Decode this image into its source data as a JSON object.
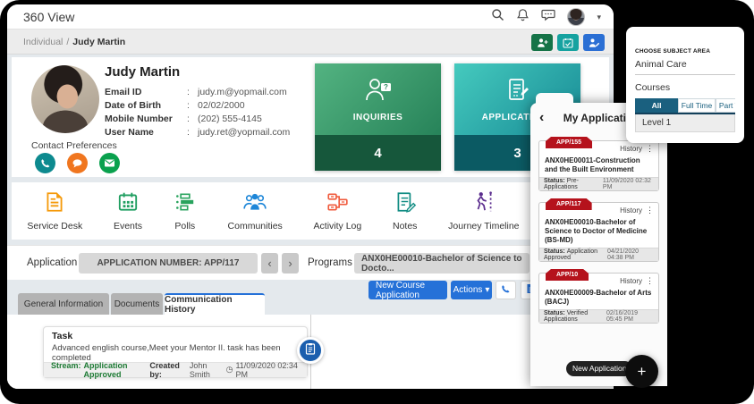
{
  "colors": {
    "primary_blue": "#2571d8",
    "inquiries_green": "#2c8a5f",
    "applications_teal": "#1ba0a5",
    "ribbon_red": "#b5121c",
    "segment_active": "#1a607f",
    "stream_green": "#1d7a34",
    "frame_black": "#000000"
  },
  "icons": {
    "caret": "▾",
    "chevron_left": "‹",
    "chevron_right": "›",
    "back": "‹",
    "ellipsis": "⋮",
    "plus": "+",
    "clock": "◷",
    "breadcrumb_sep": "/"
  },
  "topbar": {
    "title": "360 View"
  },
  "breadcrumb": {
    "section": "Individual",
    "current": "Judy Martin"
  },
  "profile": {
    "name": "Judy Martin",
    "colon": ":",
    "fields": [
      {
        "label": "Email ID",
        "value": "judy.m@yopmail.com"
      },
      {
        "label": "Date of Birth",
        "value": "02/02/2000"
      },
      {
        "label": "Mobile Number",
        "value": "(202) 555-4145"
      },
      {
        "label": "User Name",
        "value": "judy.ret@yopmail.com"
      }
    ],
    "contact_label": "Contact Preferences"
  },
  "metrics": [
    {
      "label": "INQUIRIES",
      "count": "4"
    },
    {
      "label": "APPLICATIONS",
      "count": "3"
    }
  ],
  "quick_links": [
    {
      "label": "Service Desk"
    },
    {
      "label": "Events"
    },
    {
      "label": "Polls"
    },
    {
      "label": "Communities"
    },
    {
      "label": "Activity Log"
    },
    {
      "label": "Notes"
    },
    {
      "label": "Journey Timeline"
    }
  ],
  "app_bar": {
    "application_label": "Application",
    "application_number": "APPLICATION NUMBER: APP/117",
    "programs_label": "Programs",
    "program_value": "ANX0HE00010-Bachelor of Science to Docto..."
  },
  "actions": {
    "new_course": "New Course Application",
    "actions_label": "Actions"
  },
  "tabs": [
    {
      "label": "General Information"
    },
    {
      "label": "Documents"
    },
    {
      "label": "Communication History"
    }
  ],
  "task": {
    "title": "Task",
    "body": "Advanced english course,Meet your Mentor II. task has been completed",
    "stream_label": "Stream:",
    "stream_value": "Application Approved",
    "created_label": "Created by:",
    "created_by": "John Smith",
    "created_at": "11/09/2020 02:34 PM"
  },
  "subject": {
    "label": "CHOOSE SUBJECT AREA",
    "value": "Animal Care",
    "courses_label": "Courses",
    "tabs": [
      {
        "label": "All"
      },
      {
        "label": "Full Time"
      },
      {
        "label": "Part Time"
      }
    ],
    "level": "Level 1"
  },
  "myapps": {
    "title": "My Application",
    "items": [
      {
        "ribbon": "APP/155",
        "history_label": "History",
        "name": "ANX0HE00011-Construction and the Built Environment",
        "status_label": "Status:",
        "status": "Pre-Applications",
        "date": "11/09/2020 02:32 PM"
      },
      {
        "ribbon": "APP/117",
        "history_label": "History",
        "name": "ANX0HE00010-Bachelor of Science to Doctor of Medicine (BS-MD)",
        "status_label": "Status:",
        "status": "Application Approved",
        "date": "04/21/2020 04:38 PM"
      },
      {
        "ribbon": "APP/10",
        "history_label": "History",
        "name": "ANX0HE00009-Bachelor of Arts (BACJ)",
        "status_label": "Status:",
        "status": "Verified Applications",
        "date": "02/16/2019 05:45 PM"
      }
    ]
  },
  "fab": {
    "tooltip": "New Application"
  }
}
